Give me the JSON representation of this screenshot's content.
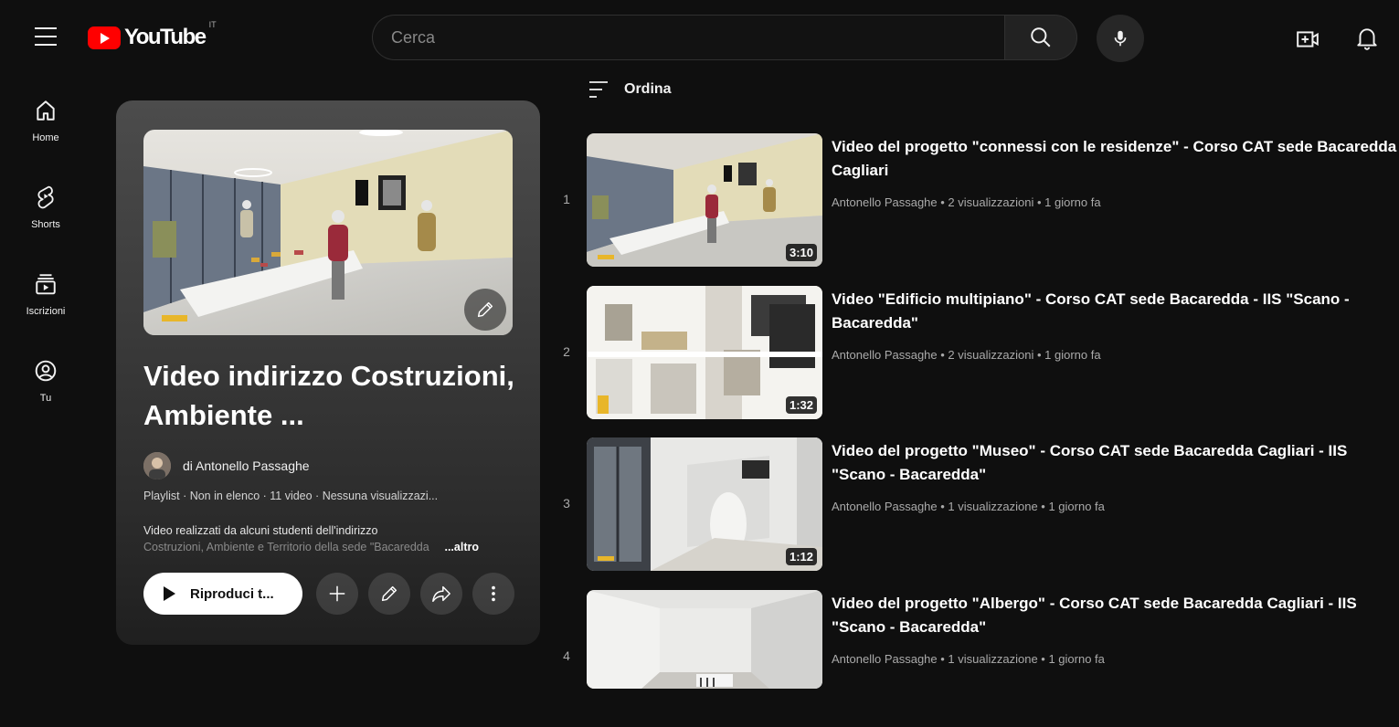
{
  "header": {
    "logo_text": "YouTube",
    "country_code": "IT",
    "search_placeholder": "Cerca"
  },
  "sidebar": {
    "items": [
      {
        "label": "Home",
        "icon": "home-icon"
      },
      {
        "label": "Shorts",
        "icon": "shorts-icon"
      },
      {
        "label": "Iscrizioni",
        "icon": "subscriptions-icon"
      },
      {
        "label": "Tu",
        "icon": "you-icon"
      }
    ]
  },
  "playlist": {
    "title": "Video indirizzo Costruzioni, Ambiente ...",
    "owner": "di Antonello Passaghe",
    "meta": "Playlist · Non in elenco · 11 video · Nessuna visualizzazi...",
    "description_line1": "Video realizzati da alcuni studenti dell'indirizzo",
    "description_line2": "Costruzioni, Ambiente e Territorio della sede \"Bacaredda",
    "more_label": "...altro",
    "play_all_label": "Riproduci t..."
  },
  "sort_label": "Ordina",
  "videos": [
    {
      "index": "1",
      "title": "Video del progetto \"connessi con le residenze\" - Corso CAT sede Bacaredda Cagliari",
      "meta": "Antonello Passaghe • 2 visualizzazioni • 1 giorno fa",
      "duration": "3:10"
    },
    {
      "index": "2",
      "title": "Video \"Edificio multipiano\" - Corso CAT sede Bacaredda - IIS \"Scano - Bacaredda\"",
      "meta": "Antonello Passaghe • 2 visualizzazioni • 1 giorno fa",
      "duration": "1:32"
    },
    {
      "index": "3",
      "title": "Video del progetto \"Museo\" - Corso CAT sede Bacaredda Cagliari - IIS \"Scano - Bacaredda\"",
      "meta": "Antonello Passaghe • 1 visualizzazione • 1 giorno fa",
      "duration": "1:12"
    },
    {
      "index": "4",
      "title": "Video del progetto \"Albergo\" - Corso CAT sede Bacaredda Cagliari - IIS \"Scano - Bacaredda\"",
      "meta": "Antonello Passaghe • 1 visualizzazione • 1 giorno fa",
      "duration": ""
    }
  ],
  "colors": {
    "background": "#0f0f0f",
    "brand_red": "#ff0000",
    "text": "#f1f1f1",
    "secondary_text": "#aaaaaa"
  }
}
